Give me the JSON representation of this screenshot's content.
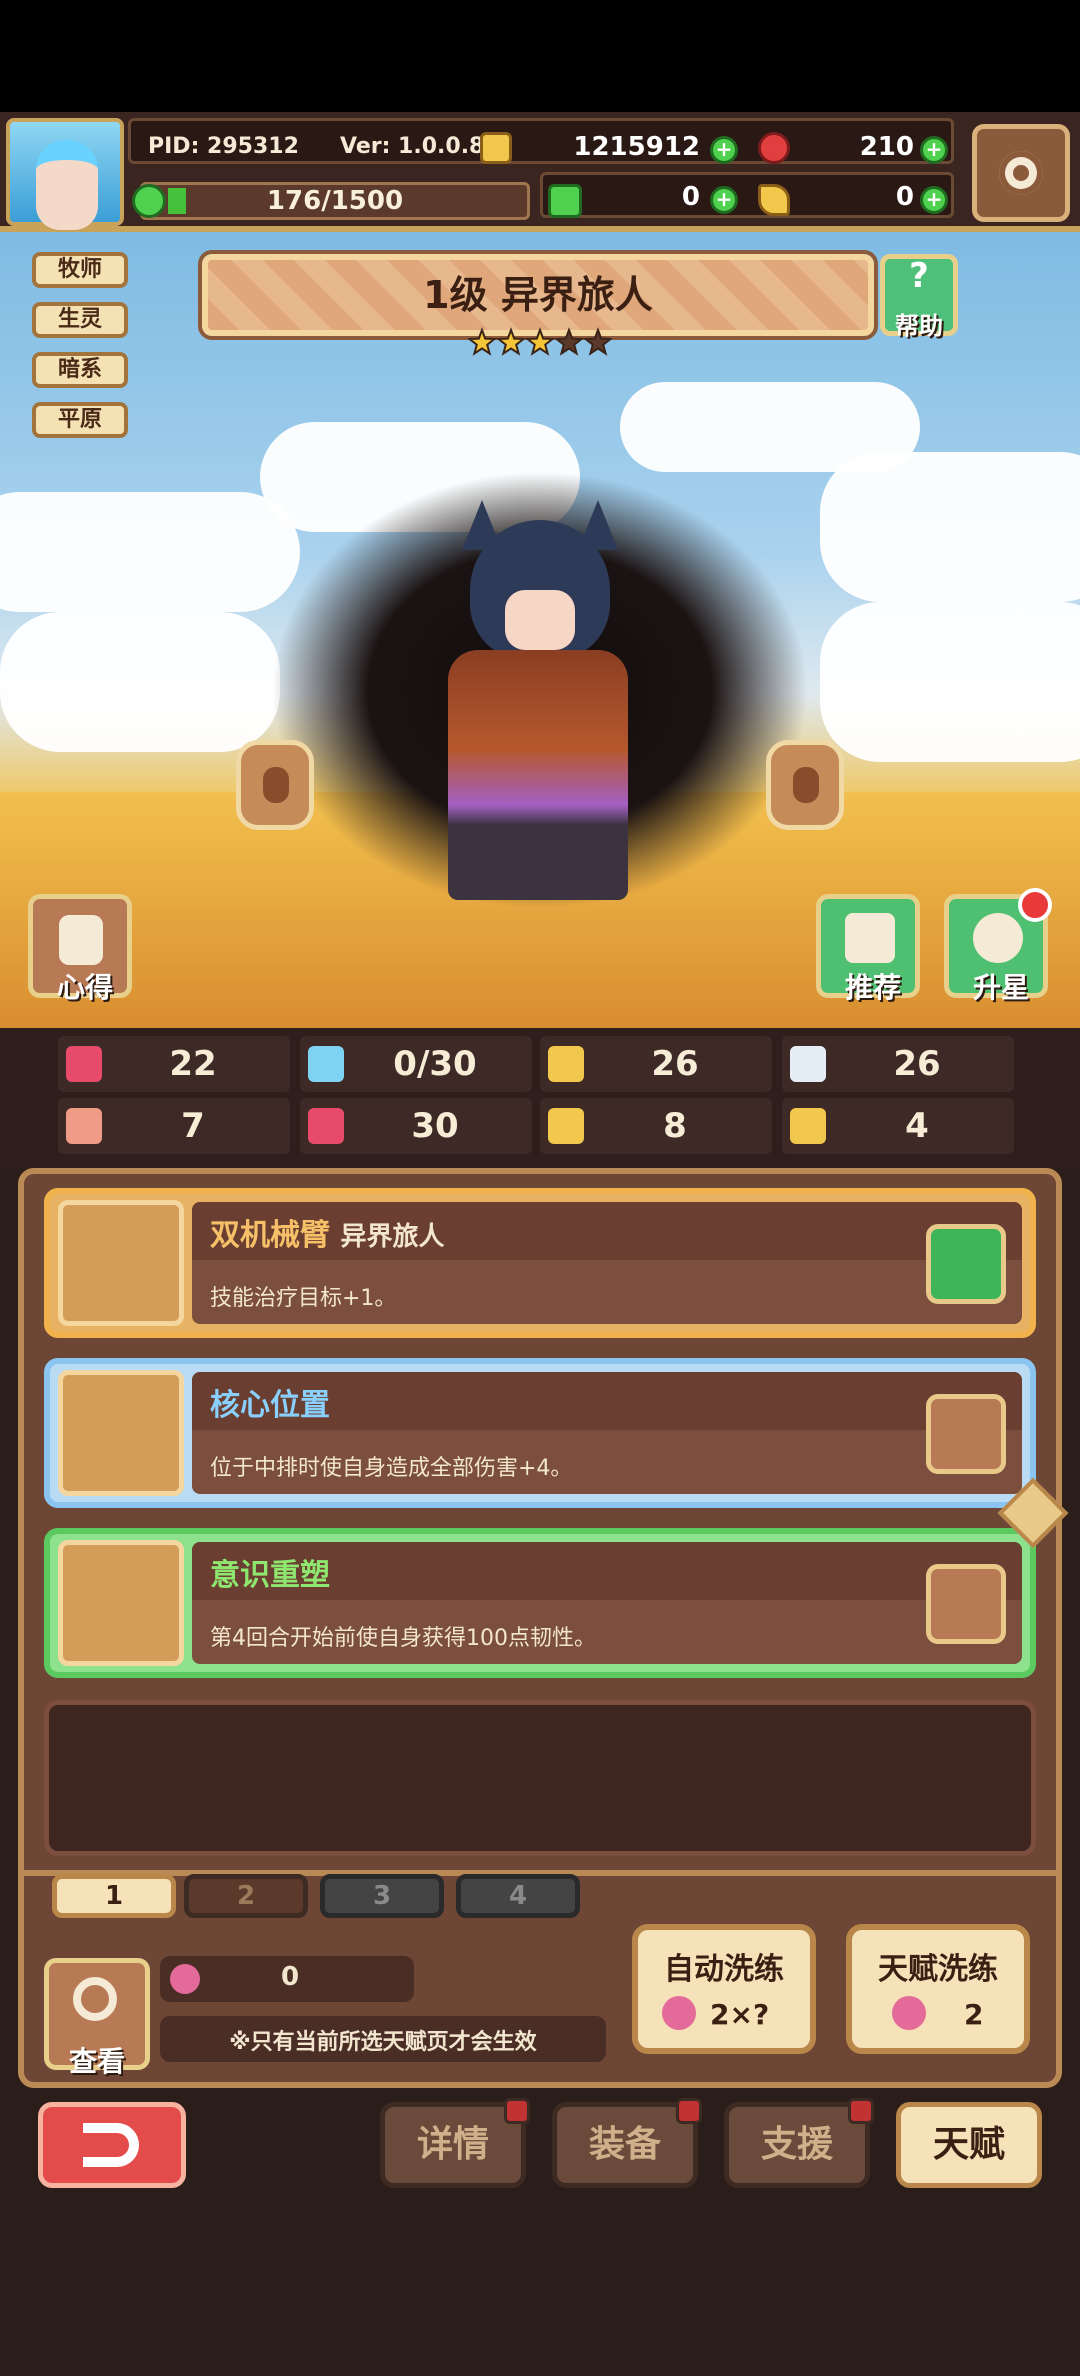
{
  "header": {
    "pid": "PID: 295312",
    "ver": "Ver: 1.0.0.8",
    "gold": "1215912",
    "gems": "210",
    "stamina": "176/1500",
    "clover": "0",
    "key": "0"
  },
  "tags": [
    "牧师",
    "生灵",
    "暗系",
    "平原"
  ],
  "hero": {
    "title": "1级  异界旅人",
    "stars_filled": 3,
    "stars_total": 5,
    "help_label": "帮助"
  },
  "side_buttons": {
    "xinde": "心得",
    "tuijian": "推荐",
    "shengxing": "升星"
  },
  "stats": [
    {
      "icon": "heart-icon",
      "value": "22"
    },
    {
      "icon": "water-drop-icon",
      "value": "0/30"
    },
    {
      "icon": "shield-icon",
      "value": "26"
    },
    {
      "icon": "feather-icon",
      "value": "26"
    },
    {
      "icon": "fist-icon",
      "value": "7"
    },
    {
      "icon": "spellbook-icon",
      "value": "30"
    },
    {
      "icon": "boot-icon",
      "value": "8"
    },
    {
      "icon": "horseshoe-icon",
      "value": "4"
    }
  ],
  "talents": [
    {
      "title": "双机械臂",
      "subtitle": "异界旅人",
      "desc": "技能治疗目标+1。",
      "locked": true,
      "color": "#f6c069"
    },
    {
      "title": "核心位置",
      "subtitle": "",
      "desc": "位于中排时使自身造成全部伤害+4。",
      "locked": false,
      "color": "#8ad0ff"
    },
    {
      "title": "意识重塑",
      "subtitle": "",
      "desc": "第4回合开始前使自身获得100点韧性。",
      "locked": false,
      "color": "#8ee66f"
    }
  ],
  "pages": [
    "1",
    "2",
    "3",
    "4"
  ],
  "active_page": "1",
  "bottom": {
    "view_label": "查看",
    "seed_count": "0",
    "note": "※只有当前所选天赋页才会生效",
    "auto_wash_title": "自动洗练",
    "auto_wash_cost": "2×?",
    "talent_wash_title": "天赋洗练",
    "talent_wash_cost": "2"
  },
  "footer": {
    "details": "详情",
    "equip": "装备",
    "support": "支援",
    "talent": "天赋"
  }
}
